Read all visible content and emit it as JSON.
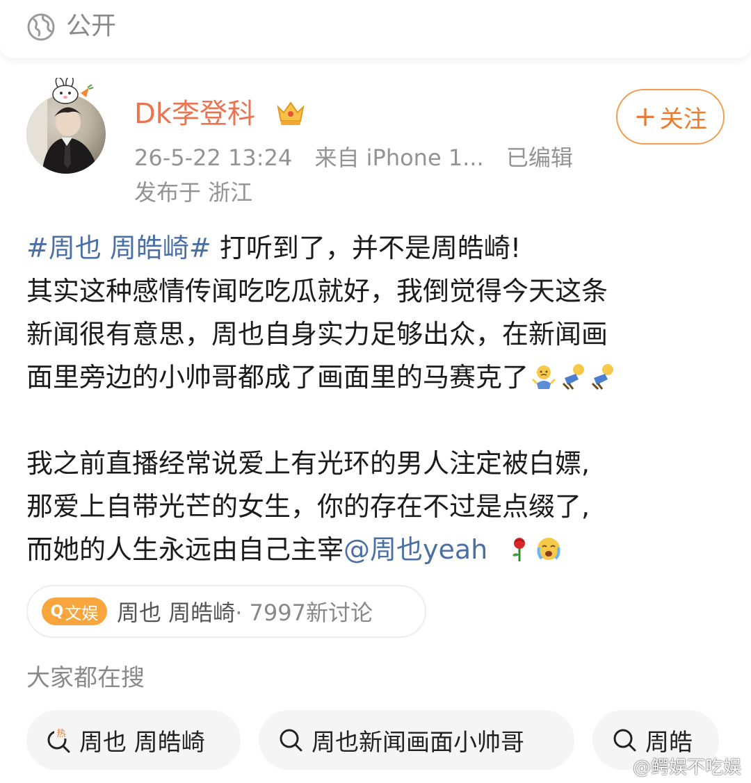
{
  "header": {
    "visibility_label": "公开"
  },
  "post": {
    "author": "Dk李登科",
    "timestamp": "26-5-22 13:24",
    "source": "来自 iPhone 1...",
    "edited": "已编辑",
    "location": "发布于 浙江",
    "follow_label": "关注",
    "hashtag": "#周也 周皓崎#",
    "line1_rest": " 打听到了，并不是周皓崎!",
    "line2": "其实这种感情传闻吃吃瓜就好，我倒觉得今天这条",
    "line3": "新闻很有意思，周也自身实力足够出众，在新闻画",
    "line4": "面里旁边的小帅哥都成了画面里的马赛克了",
    "para2_line1": "我之前直播经常说爱上有光环的男人注定被白嫖,",
    "para2_line2": "那爱上自带光芒的女生，你的存在不过是点缀了,",
    "para2_line3": "而她的人生永远由自己主宰",
    "mention": "@周也yeah"
  },
  "topic": {
    "badge": "文娱",
    "name": "周也 周皓崎",
    "count": " · 7997新讨论"
  },
  "search": {
    "heading": "大家都在搜",
    "chips": [
      {
        "label": "周也 周皓崎",
        "icon": "hot-search-icon"
      },
      {
        "label": "周也新闻画面小帅哥",
        "icon": "search-icon"
      },
      {
        "label": "周皓",
        "icon": "search-icon"
      }
    ]
  },
  "watermark": "@鳄娱不吃娱",
  "colors": {
    "accent": "#eb7350",
    "link": "#4a6fa5",
    "follow_border": "#f39c4a",
    "badge": "#f7a53c"
  }
}
